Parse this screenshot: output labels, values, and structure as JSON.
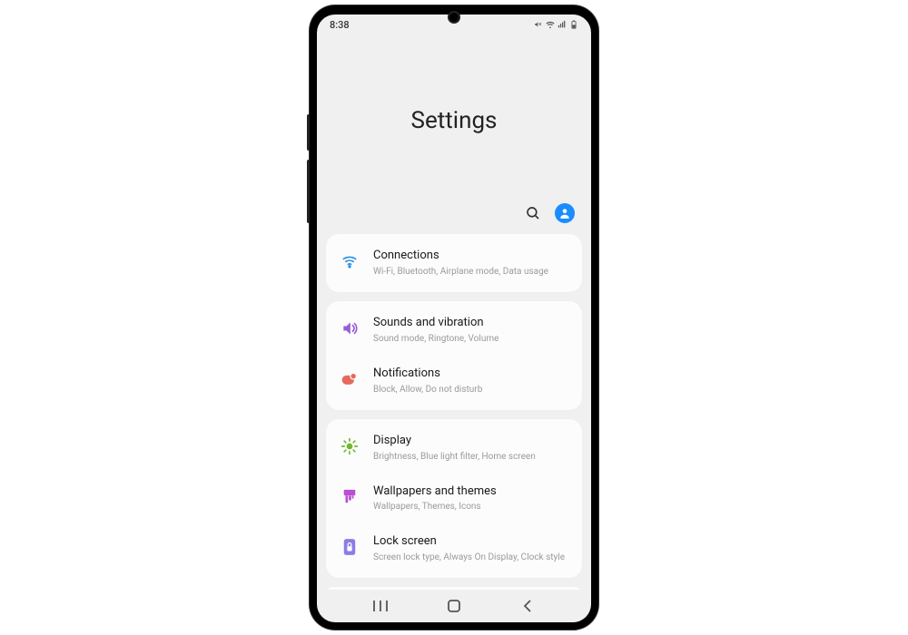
{
  "status_bar": {
    "time": "8:38"
  },
  "header": {
    "title": "Settings"
  },
  "groups": [
    {
      "items": [
        {
          "id": "connections",
          "title": "Connections",
          "subtitle": "Wi-Fi, Bluetooth, Airplane mode, Data usage",
          "icon": "wifi",
          "color": "#2b8fe6"
        }
      ]
    },
    {
      "items": [
        {
          "id": "sounds",
          "title": "Sounds and vibration",
          "subtitle": "Sound mode, Ringtone, Volume",
          "icon": "sound",
          "color": "#9a5cd6"
        },
        {
          "id": "notifications",
          "title": "Notifications",
          "subtitle": "Block, Allow, Do not disturb",
          "icon": "notif",
          "color": "#e66a5c"
        }
      ]
    },
    {
      "items": [
        {
          "id": "display",
          "title": "Display",
          "subtitle": "Brightness, Blue light filter, Home screen",
          "icon": "display",
          "color": "#6fb82e"
        },
        {
          "id": "wallpapers",
          "title": "Wallpapers and themes",
          "subtitle": "Wallpapers, Themes, Icons",
          "icon": "brush",
          "color": "#b94fd1"
        },
        {
          "id": "lockscreen",
          "title": "Lock screen",
          "subtitle": "Screen lock type, Always On Display, Clock style",
          "icon": "lock",
          "color": "#8a7de8"
        }
      ]
    }
  ]
}
